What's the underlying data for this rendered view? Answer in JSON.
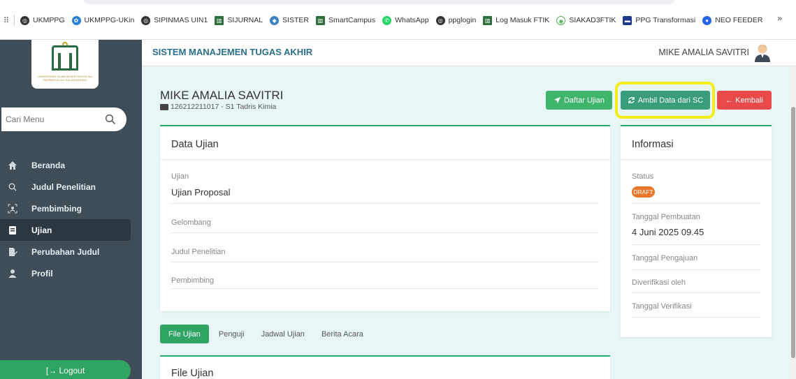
{
  "bookmarks": [
    {
      "label": "UKMPPG",
      "icon": "globe-icon",
      "color": "#333333"
    },
    {
      "label": "UKMPPG-UKin",
      "icon": "university-icon",
      "color": "#2a7fd4"
    },
    {
      "label": "SIPINMAS UIN1",
      "icon": "globe-icon",
      "color": "#333333"
    },
    {
      "label": "SIJURNAL",
      "icon": "building-icon",
      "color": "#2f6f3e"
    },
    {
      "label": "SISTER",
      "icon": "sister-icon",
      "color": "#3b82c4"
    },
    {
      "label": "SmartCampus",
      "icon": "building-icon",
      "color": "#2f6f3e"
    },
    {
      "label": "WhatsApp",
      "icon": "whatsapp-icon",
      "color": "#25d366"
    },
    {
      "label": "ppglogin",
      "icon": "globe-icon",
      "color": "#333333"
    },
    {
      "label": "Log Masuk FTIK",
      "icon": "building-icon",
      "color": "#2f6f3e"
    },
    {
      "label": "SIAKAD3FTIK",
      "icon": "siakad-icon",
      "color": "#4caf50"
    },
    {
      "label": "PPG Transformasi",
      "icon": "ppg-icon",
      "color": "#1e3a8a"
    },
    {
      "label": "NEO FEEDER",
      "icon": "feeder-icon",
      "color": "#2563eb"
    }
  ],
  "bookmarks_more": "»",
  "sidebar": {
    "logo_text": "UNIVERSITAS ISLAM NEGERI SAYYID ALI RAHMATULLAH TULUNGAGUNG",
    "search_placeholder": "Cari Menu",
    "items": [
      {
        "label": "Beranda",
        "icon": "home-icon",
        "active": false
      },
      {
        "label": "Judul Penelitian",
        "icon": "search-icon",
        "active": false
      },
      {
        "label": "Pembimbing",
        "icon": "people-icon",
        "active": false
      },
      {
        "label": "Ujian",
        "icon": "book-icon",
        "active": true
      },
      {
        "label": "Perubahan Judul",
        "icon": "edit-file-icon",
        "active": false
      },
      {
        "label": "Profil",
        "icon": "user-icon",
        "active": false
      }
    ],
    "logout_label": "[→ Logout"
  },
  "header": {
    "title": "SISTEM MANAJEMEN TUGAS AKHIR",
    "user_name": "MIKE AMALIA SAVITRI"
  },
  "student": {
    "name": "MIKE AMALIA SAVITRI",
    "meta": "126212211017 - S1 Tadris Kimia"
  },
  "actions": {
    "daftar_label": "Daftar Ujian",
    "ambil_label": "Ambil Data dari SC",
    "kembali_label": "← Kembali"
  },
  "data_ujian": {
    "title": "Data Ujian",
    "fields": [
      {
        "label": "Ujian",
        "value": "Ujian Proposal"
      },
      {
        "label": "Gelombang",
        "value": ""
      },
      {
        "label": "Judul Penelitian",
        "value": ""
      },
      {
        "label": "Pembimbing",
        "value": ""
      }
    ]
  },
  "informasi": {
    "title": "Informasi",
    "status_label": "Status",
    "status_value": "DRAFT",
    "status_color": "#e9782b",
    "tanggal_pembuatan_label": "Tanggal Pembuatan",
    "tanggal_pembuatan_value": "4 Juni 2025 09.45",
    "tanggal_pengajuan_label": "Tanggal Pengajuan",
    "diverifikasi_label": "Diverifikasi oleh",
    "tanggal_verifikasi_label": "Tanggal Verifikasi"
  },
  "tabs": [
    {
      "label": "File Ujian",
      "active": true
    },
    {
      "label": "Penguji",
      "active": false
    },
    {
      "label": "Jadwal Ujian",
      "active": false
    },
    {
      "label": "Berita Acara",
      "active": false
    }
  ],
  "file_card": {
    "title": "File Ujian"
  },
  "colors": {
    "accent": "#2fa463",
    "sidebar": "#3f4d58",
    "highlight": "#f2ee1a",
    "danger": "#e84a4a"
  }
}
